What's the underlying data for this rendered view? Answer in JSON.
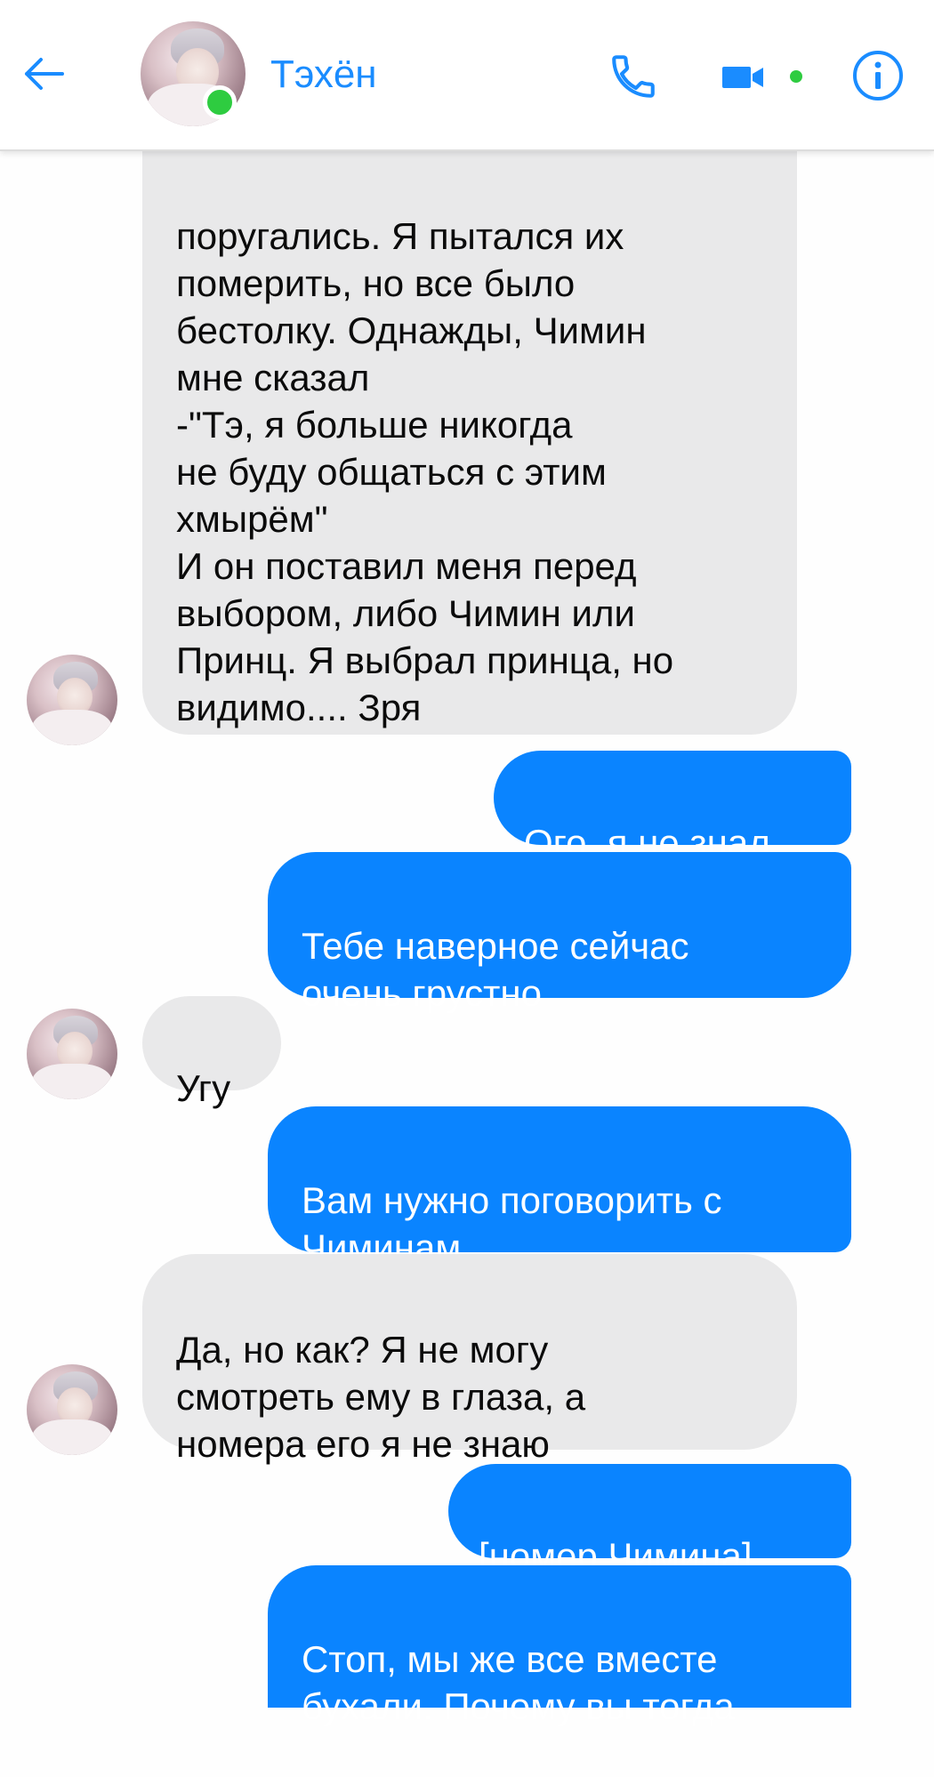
{
  "header": {
    "contact_name": "Тэхён",
    "online": true,
    "accent_color": "#1a8cff",
    "status_color": "#2ecc40",
    "icons": {
      "back": "arrow-left-icon",
      "call": "phone-icon",
      "video": "video-camera-icon",
      "info": "info-icon"
    }
  },
  "messages": [
    {
      "from": "them",
      "text": "поругались. Я пытался их\nпомерить, но все было\nбестолку. Однажды, Чимин\nмне сказал\n-\"Тэ, я больше никогда\nне буду общаться с этим\nхмырём\"\nИ он поставил меня перед\nвыбором, либо Чимин или\nПринц. Я выбрал принца, но\nвидимо.... Зря"
    },
    {
      "from": "me",
      "text": "Ого, я не знал"
    },
    {
      "from": "me",
      "text": "Тебе наверное сейчас\nочень грустно"
    },
    {
      "from": "them",
      "text": "Угу"
    },
    {
      "from": "me",
      "text": "Вам нужно поговорить с\nЧиминам"
    },
    {
      "from": "them",
      "text": "Да, но как? Я не могу\nсмотреть ему в глаза, а\nномера его я не знаю"
    },
    {
      "from": "me",
      "text": "[номер Чимина]"
    },
    {
      "from": "me",
      "text": "Стоп, мы же все вместе\nбухали. Почему вы тогда"
    }
  ],
  "colors": {
    "incoming_bubble": "#e9e9ea",
    "outgoing_bubble": "#0a84ff"
  }
}
